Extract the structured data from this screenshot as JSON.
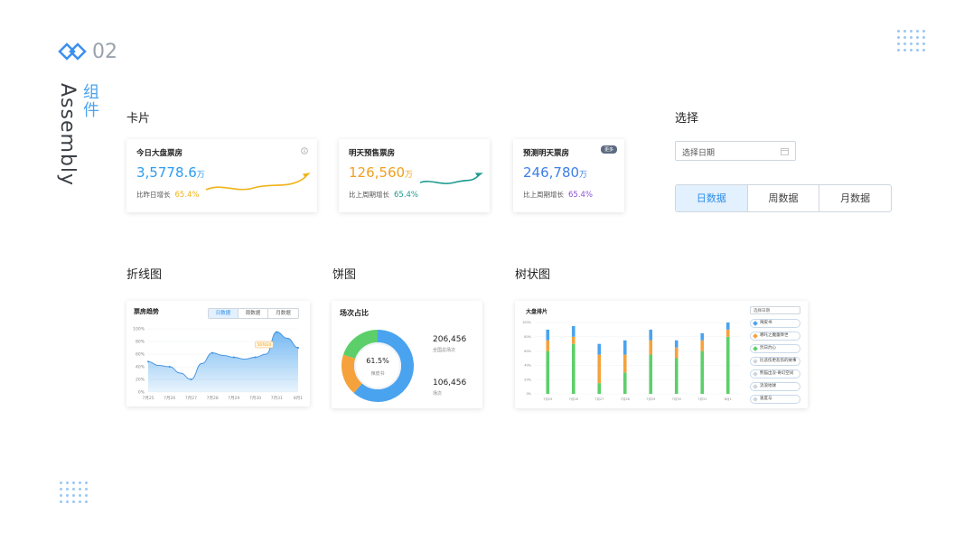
{
  "header": {
    "number": "02",
    "title_en": "Assembly",
    "title_cn": "组件"
  },
  "sections": {
    "cards": "卡片",
    "select": "选择",
    "line": "折线图",
    "pie": "饼图",
    "bar": "树状图"
  },
  "cards": [
    {
      "title": "今日大盘票房",
      "value": "3,5778.6",
      "unit": "万",
      "growth_label": "比昨日增长",
      "growth": "65.4%",
      "color": "#2d9cf0",
      "accent": "#f0b419"
    },
    {
      "title": "明天预售票房",
      "value": "126,560",
      "unit": "万",
      "growth_label": "比上周期增长",
      "growth": "65.4%",
      "color": "#f0a020",
      "accent": "#1f9b8f"
    },
    {
      "title": "预测明天票房",
      "value": "246,780",
      "unit": "万",
      "growth_label": "比上周期增长",
      "growth": "65.4%",
      "color": "#3d7fe6",
      "accent": "#8a4fd6",
      "badge": "更多"
    }
  ],
  "select": {
    "date_placeholder": "选择日期",
    "segments": [
      "日数据",
      "周数据",
      "月数据"
    ],
    "active": 0
  },
  "line_card": {
    "title": "票房趋势",
    "tabs": [
      "日数据",
      "周数据",
      "月数据"
    ],
    "tooltip": "567624",
    "color": "#4aa3ee"
  },
  "pie_card": {
    "title": "场次占比",
    "center_value": "61.5%",
    "center_label": "辣皮书",
    "stat1_value": "206,456",
    "stat1_label": "全国总场次",
    "stat2_value": "106,456",
    "stat2_label": "场次"
  },
  "bar_card": {
    "title": "大盘排片",
    "select_placeholder": "选择日期",
    "legend": [
      {
        "name": "辣皮书",
        "color": "#4aa3ee"
      },
      {
        "name": "哪吒之魔童降世",
        "color": "#f5a23c"
      },
      {
        "name": "烈日灼心",
        "color": "#5ccf6a"
      },
      {
        "name": "比悲伤更悲伤的故事",
        "color": "#cfd6de"
      },
      {
        "name": "熊猫出没·奇幻空间",
        "color": "#cfd6de"
      },
      {
        "name": "流浪地球",
        "color": "#cfd6de"
      },
      {
        "name": "速度与",
        "color": "#cfd6de"
      }
    ]
  },
  "chart_data": [
    {
      "type": "area",
      "title": "票房趋势",
      "categories": [
        "7月25",
        "7月26",
        "7月27",
        "7月28",
        "7月29",
        "7月30",
        "7月31",
        "8月1"
      ],
      "y_ticks": [
        "100%",
        "80%",
        "60%",
        "40%",
        "20%",
        "0%"
      ],
      "ylim": [
        0,
        100
      ],
      "x": [
        0,
        0.5,
        1,
        1.5,
        2,
        2.5,
        3,
        3.5,
        4,
        4.5,
        5,
        5.5,
        6,
        6.5,
        7
      ],
      "values": [
        48,
        42,
        40,
        30,
        20,
        45,
        62,
        58,
        55,
        52,
        55,
        60,
        95,
        85,
        70
      ]
    },
    {
      "type": "pie",
      "title": "场次占比",
      "slices": [
        {
          "label": "蓝",
          "value": 61.5,
          "color": "#4aa3ee"
        },
        {
          "label": "橙",
          "value": 18.5,
          "color": "#f5a23c"
        },
        {
          "label": "绿",
          "value": 20,
          "color": "#5ccf6a"
        }
      ]
    },
    {
      "type": "bar",
      "title": "大盘排片",
      "categories": [
        "7月25",
        "7月26",
        "7月27",
        "7月28",
        "7月29",
        "7月30",
        "7月31",
        "8月1"
      ],
      "y_ticks": [
        "100%",
        "80%",
        "60%",
        "40%",
        "20%",
        "0%"
      ],
      "ylim": [
        0,
        100
      ],
      "series": [
        {
          "name": "辣皮书",
          "values": [
            60,
            70,
            15,
            30,
            55,
            50,
            60,
            80
          ],
          "color": "#5ccf6a"
        },
        {
          "name": "哪吒之魔童降世",
          "values": [
            15,
            10,
            40,
            25,
            20,
            15,
            15,
            10
          ],
          "color": "#f5a23c"
        },
        {
          "name": "烈日灼心",
          "values": [
            15,
            15,
            15,
            20,
            15,
            10,
            10,
            10
          ],
          "color": "#4aa3ee"
        }
      ]
    }
  ]
}
